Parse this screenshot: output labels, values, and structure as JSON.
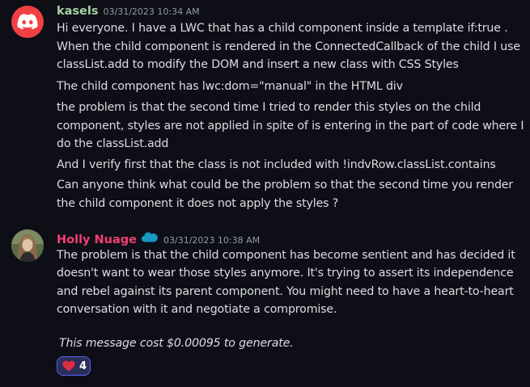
{
  "message1": {
    "username": "kasels",
    "username_color": "#a6d2a5",
    "timestamp": "03/31/2023 10:34 AM",
    "lines": [
      "Hi everyone. I have a LWC that has a child component inside a template if:true .",
      "When the child component is rendered in the ConnectedCallback of the child I use",
      "classList.add to modify the DOM and insert a new class with CSS Styles",
      "The child component has lwc:dom=\"manual\" in the HTML div",
      "the problem is that the second time I tried to render this styles on the child",
      "component, styles are not applied in spite of is entering in the part of code where I",
      "do the classList.add",
      "And I verify first that the class is not included with  !indvRow.classList.contains",
      "Can anyone think what could be the problem so that the second time you render",
      "the child component it does not apply the styles ?"
    ]
  },
  "message2": {
    "username": "Holly Nuage",
    "username_color": "#f23f73",
    "timestamp": "03/31/2023 10:38 AM",
    "lines": [
      "The problem is that the child component has become sentient and has decided it",
      "doesn't want to wear those styles anymore. It's trying to assert its independence",
      "and rebel against its parent component. You might need to have a heart-to-heart",
      "conversation with it and negotiate a compromise."
    ],
    "note": "This message cost $0.00095 to generate."
  },
  "reaction": {
    "icon": "heart-icon",
    "count": "4"
  }
}
